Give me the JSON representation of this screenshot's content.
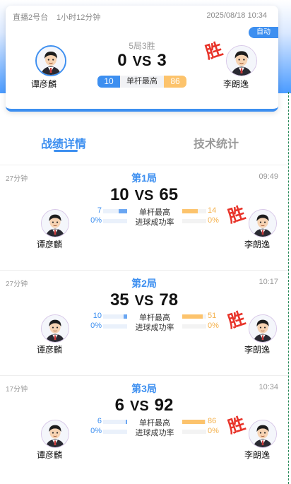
{
  "colors": {
    "accent": "#3d8ff0",
    "secondary": "#fcc36c",
    "win": "#e8342a"
  },
  "header": {
    "venue": "直播2号台",
    "duration": "1小时12分钟",
    "datetime": "2025/08/18 10:34",
    "auto_badge": "自动",
    "format": "5局3胜",
    "player1": {
      "name": "谭彦麟",
      "score": "0",
      "avatar_icon": "player-avatar-icon"
    },
    "player2": {
      "name": "李朗逸",
      "score": "3",
      "avatar_icon": "player-avatar-icon"
    },
    "vs": "VS",
    "win_stamp": "胜",
    "highest_break": {
      "label": "单杆最高",
      "player1": "10",
      "player2": "86"
    }
  },
  "tabs": [
    {
      "label": "战绩详情",
      "active": true
    },
    {
      "label": "技术统计",
      "active": false
    }
  ],
  "games": [
    {
      "elapsed": "27分钟",
      "time": "09:49",
      "title": "第1局",
      "score1": "10",
      "score2": "65",
      "vs": "VS",
      "win_stamp": "胜",
      "player1": "谭彦麟",
      "player2": "李朗逸",
      "stats": [
        {
          "label": "单杆最高",
          "left": "7",
          "right": "14",
          "left_fill": 0.35,
          "right_fill": 0.65
        },
        {
          "label": "进球成功率",
          "left": "0%",
          "right": "0%",
          "left_fill": 0,
          "right_fill": 0
        }
      ]
    },
    {
      "elapsed": "27分钟",
      "time": "10:17",
      "title": "第2局",
      "score1": "35",
      "score2": "78",
      "vs": "VS",
      "win_stamp": "胜",
      "player1": "谭彦麟",
      "player2": "李朗逸",
      "stats": [
        {
          "label": "单杆最高",
          "left": "10",
          "right": "51",
          "left_fill": 0.16,
          "right_fill": 0.84
        },
        {
          "label": "进球成功率",
          "left": "0%",
          "right": "0%",
          "left_fill": 0,
          "right_fill": 0
        }
      ]
    },
    {
      "elapsed": "17分钟",
      "time": "10:34",
      "title": "第3局",
      "score1": "6",
      "score2": "92",
      "vs": "VS",
      "win_stamp": "胜",
      "player1": "谭彦麟",
      "player2": "李朗逸",
      "stats": [
        {
          "label": "单杆最高",
          "left": "6",
          "right": "86",
          "left_fill": 0.07,
          "right_fill": 0.93
        },
        {
          "label": "进球成功率",
          "left": "0%",
          "right": "0%",
          "left_fill": 0,
          "right_fill": 0
        }
      ]
    }
  ]
}
